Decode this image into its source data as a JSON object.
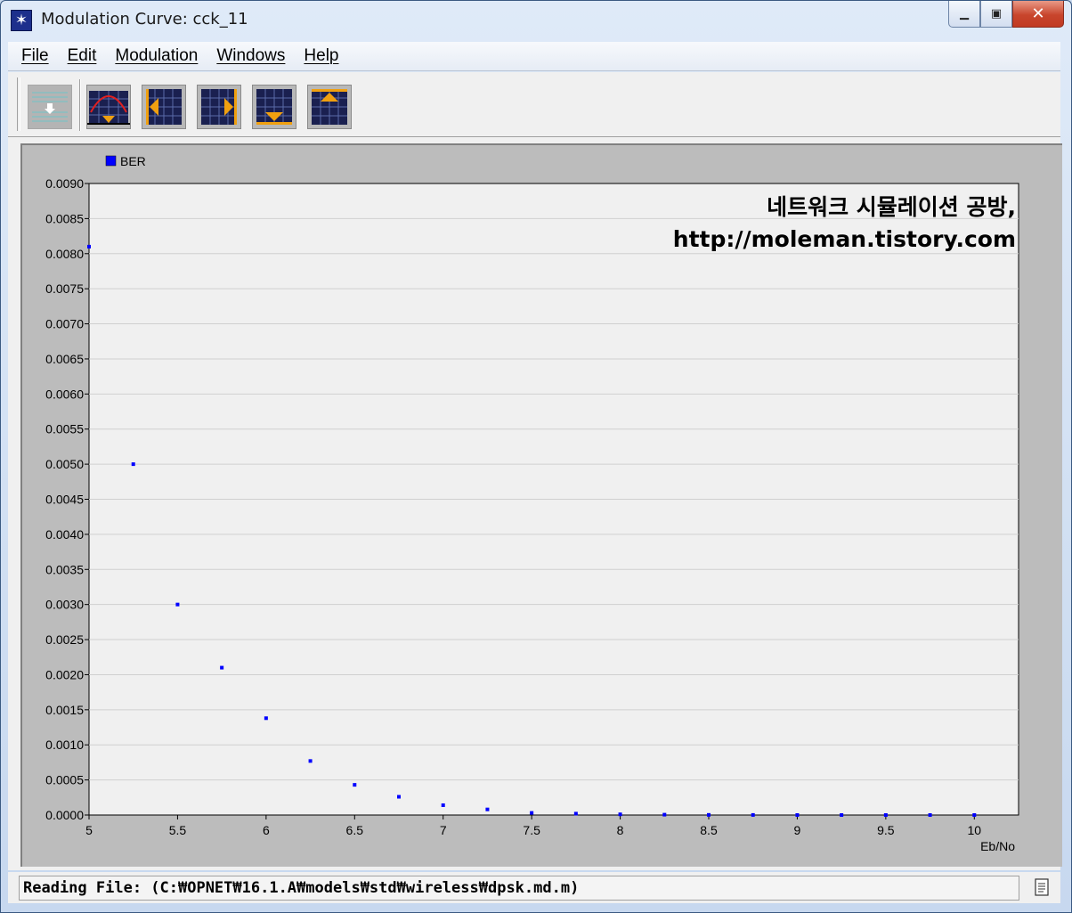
{
  "window": {
    "title": "Modulation Curve: cck_11",
    "app_icon": "star-burst-icon",
    "controls": {
      "minimize": "minimize-icon",
      "maximize": "maximize-icon",
      "close": "close-icon"
    }
  },
  "menubar": {
    "items": [
      {
        "label": "File"
      },
      {
        "label": "Edit"
      },
      {
        "label": "Modulation"
      },
      {
        "label": "Windows"
      },
      {
        "label": "Help"
      }
    ]
  },
  "toolbar": {
    "buttons": [
      {
        "icon": "copy-curve-icon"
      },
      {
        "icon": "fit-curve-icon"
      },
      {
        "icon": "shift-left-icon"
      },
      {
        "icon": "shift-right-icon"
      },
      {
        "icon": "shift-down-icon"
      },
      {
        "icon": "shift-up-icon"
      }
    ]
  },
  "watermark": {
    "line1": "네트워크 시뮬레이션 공방,",
    "line2": "http://moleman.tistory.com"
  },
  "chart_data": {
    "type": "scatter",
    "title": "",
    "xlabel": "Eb/No",
    "ylabel": "",
    "xlim": [
      5,
      10.25
    ],
    "ylim": [
      0,
      0.009
    ],
    "x_ticks": [
      "5",
      "5.5",
      "6",
      "6.5",
      "7",
      "7.5",
      "8",
      "8.5",
      "9",
      "9.5",
      "10"
    ],
    "y_ticks": [
      "0.0000",
      "0.0005",
      "0.0010",
      "0.0015",
      "0.0020",
      "0.0025",
      "0.0030",
      "0.0035",
      "0.0040",
      "0.0045",
      "0.0050",
      "0.0055",
      "0.0060",
      "0.0065",
      "0.0070",
      "0.0075",
      "0.0080",
      "0.0085",
      "0.0090"
    ],
    "grid": true,
    "legend": "top-left",
    "series": [
      {
        "name": "BER",
        "color": "#0000ff",
        "x": [
          5,
          5.25,
          5.5,
          5.75,
          6,
          6.25,
          6.5,
          6.75,
          7,
          7.25,
          7.5,
          7.75,
          8,
          8.25,
          8.5,
          8.75,
          9,
          9.25,
          9.5,
          9.75,
          10
        ],
        "y": [
          0.0081,
          0.005,
          0.003,
          0.0021,
          0.00138,
          0.00077,
          0.00043,
          0.00026,
          0.00014,
          8e-05,
          3e-05,
          2e-05,
          1e-05,
          5e-06,
          2e-06,
          1e-06,
          0,
          0,
          0,
          0,
          0
        ]
      }
    ]
  },
  "statusbar": {
    "text": "Reading File: (C:₩OPNET₩16.1.A₩models₩std₩wireless₩dpsk.md.m)",
    "icon": "document-icon"
  }
}
